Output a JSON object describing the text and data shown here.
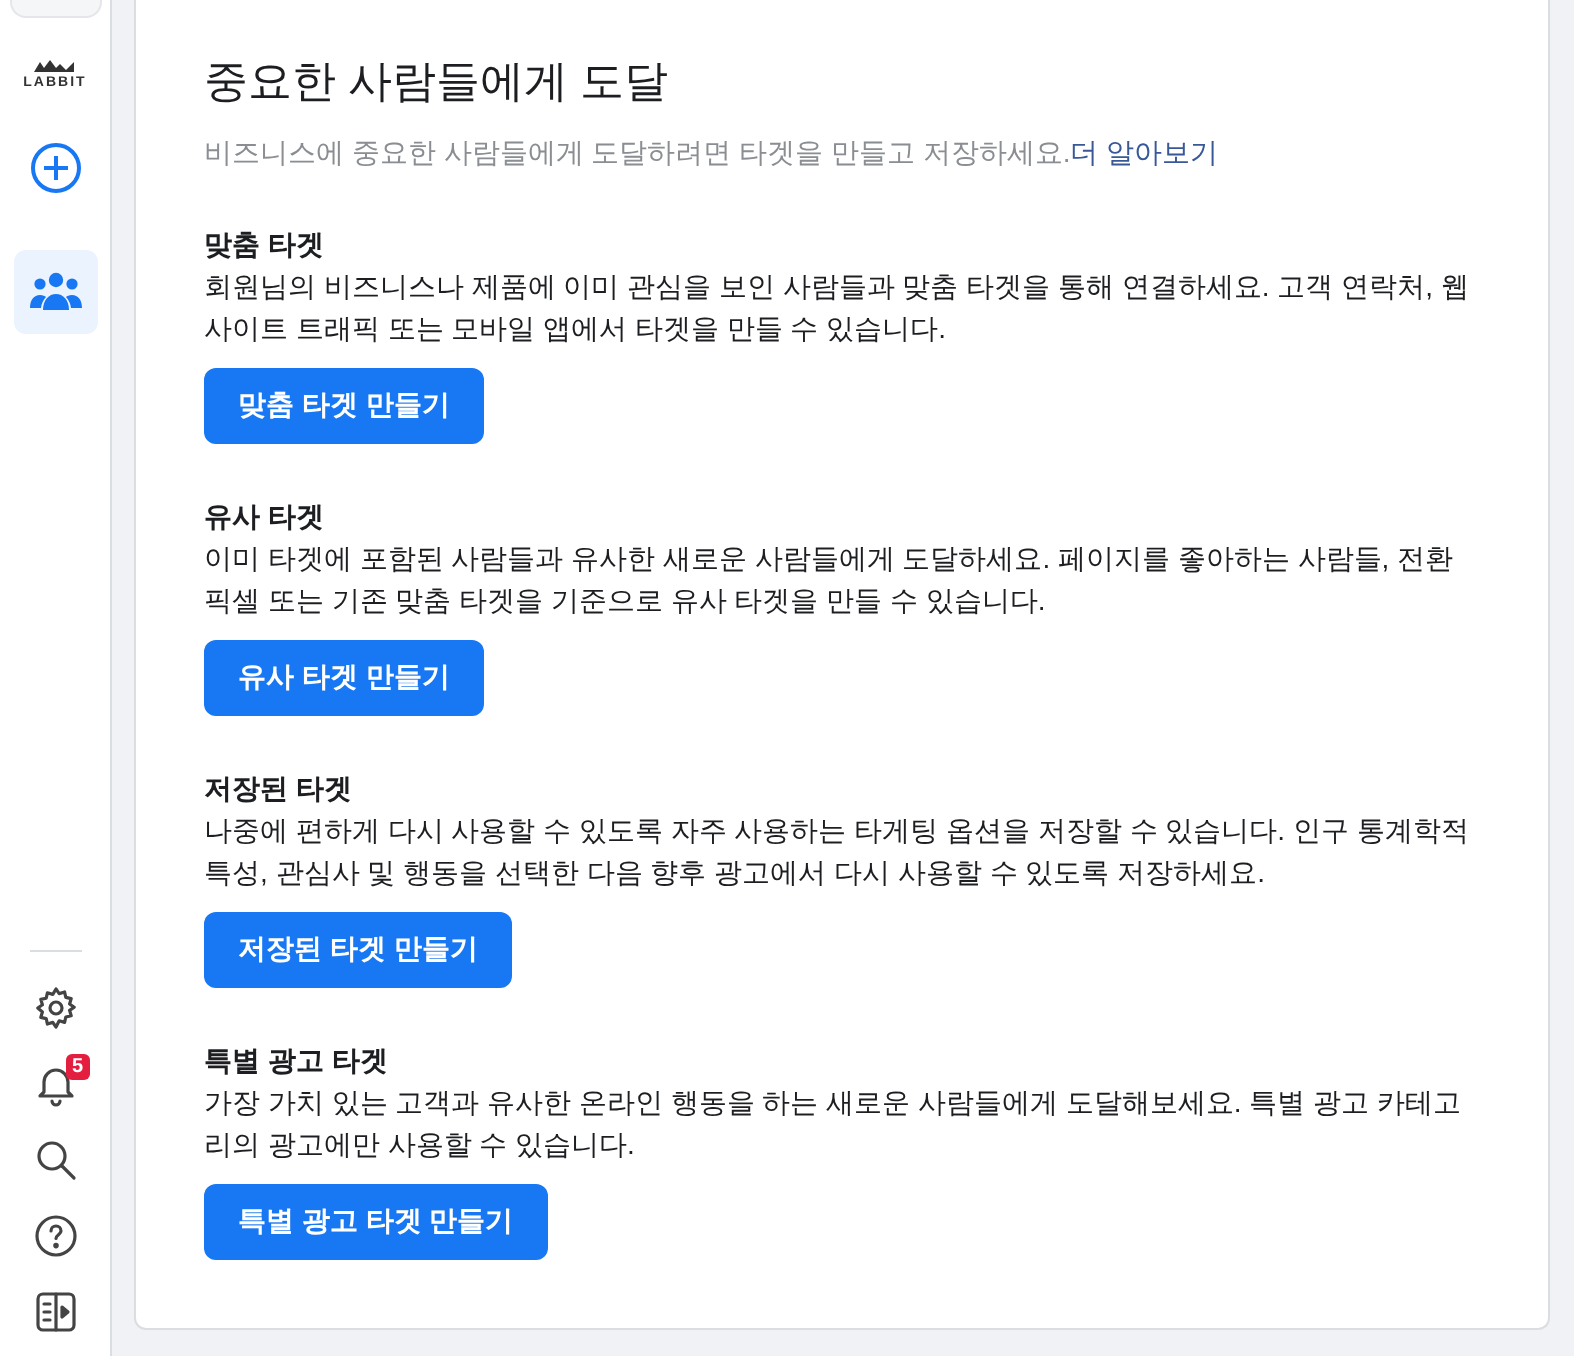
{
  "sidebar": {
    "logo": "LABBIT",
    "items": [
      {
        "kind": "create",
        "selected": false
      },
      {
        "kind": "audiences",
        "selected": true
      }
    ],
    "bottom_items": [
      {
        "kind": "settings"
      },
      {
        "kind": "notifications",
        "badge": "5"
      },
      {
        "kind": "search"
      },
      {
        "kind": "help"
      },
      {
        "kind": "panel"
      }
    ]
  },
  "main": {
    "title": "중요한 사람들에게 도달",
    "subtitle": "비즈니스에 중요한 사람들에게 도달하려면 타겟을 만들고 저장하세요.",
    "learn_more": "더 알아보기",
    "sections": [
      {
        "heading": "맞춤 타겟",
        "description": "회원님의 비즈니스나 제품에 이미 관심을 보인 사람들과 맞춤 타겟을 통해 연결하세요. 고객 연락처, 웹사이트 트래픽 또는 모바일 앱에서 타겟을 만들 수 있습니다.",
        "button": "맞춤 타겟 만들기"
      },
      {
        "heading": "유사 타겟",
        "description": "이미 타겟에 포함된 사람들과 유사한 새로운 사람들에게 도달하세요. 페이지를 좋아하는 사람들, 전환 픽셀 또는 기존 맞춤 타겟을 기준으로 유사 타겟을 만들 수 있습니다.",
        "button": "유사 타겟 만들기"
      },
      {
        "heading": "저장된 타겟",
        "description": "나중에 편하게 다시 사용할 수 있도록 자주 사용하는 타게팅 옵션을 저장할 수 있습니다. 인구 통계학적 특성, 관심사 및 행동을 선택한 다음 향후 광고에서 다시 사용할 수 있도록 저장하세요.",
        "button": "저장된 타겟 만들기"
      },
      {
        "heading": "특별 광고 타겟",
        "description": "가장 가치 있는 고객과 유사한 온라인 행동을 하는 새로운 사람들에게 도달해보세요. 특별 광고 카테고리의 광고에만 사용할 수 있습니다.",
        "button": "특별 광고 타겟 만들기"
      }
    ]
  }
}
